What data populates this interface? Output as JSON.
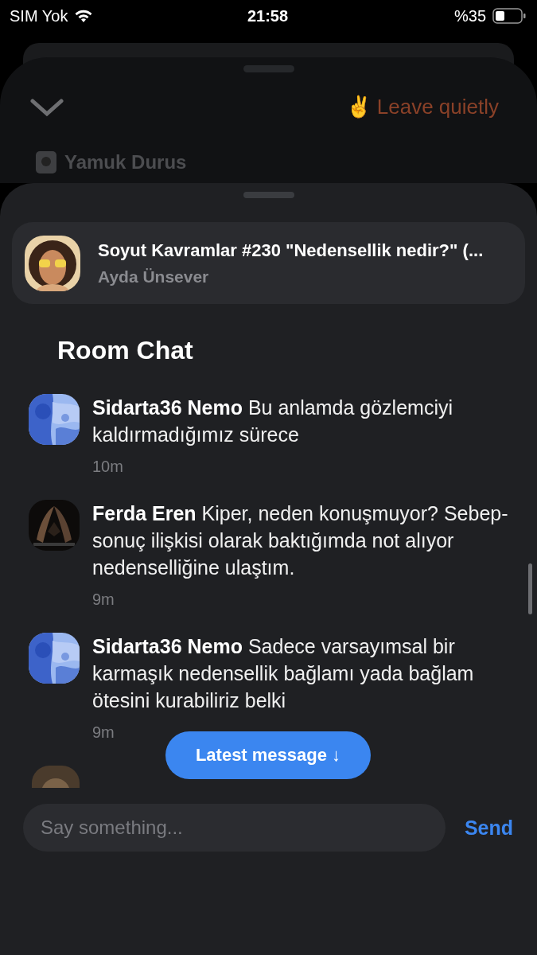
{
  "status_bar": {
    "carrier": "SIM Yok",
    "time": "21:58",
    "battery": "%35"
  },
  "back_sheet": {
    "leave_button": "✌️ Leave quietly",
    "club": "Yamuk Durus"
  },
  "room": {
    "title": "Soyut Kavramlar #230 \"Nedensellik nedir?\" (...",
    "host": "Ayda Ünsever"
  },
  "chat": {
    "title": "Room Chat",
    "messages": [
      {
        "author": "Sidarta36 Nemo",
        "text": "Bu anlamda gözlemciyi kaldırmadığımız sürece",
        "time": "10m"
      },
      {
        "author": "Ferda Eren",
        "text": "Kiper, neden konuşmuyor? Sebep-sonuç ilişkisi olarak baktığımda not alıyor nedenselliğine ulaştım.",
        "time": "9m"
      },
      {
        "author": "Sidarta36 Nemo",
        "text": "Sadece varsayımsal bir karmaşık nedensellik bağlamı yada bağlam ötesini kurabiliriz belki",
        "time": "9m"
      }
    ],
    "latest_button": "Latest message ↓"
  },
  "composer": {
    "placeholder": "Say something...",
    "send": "Send"
  }
}
